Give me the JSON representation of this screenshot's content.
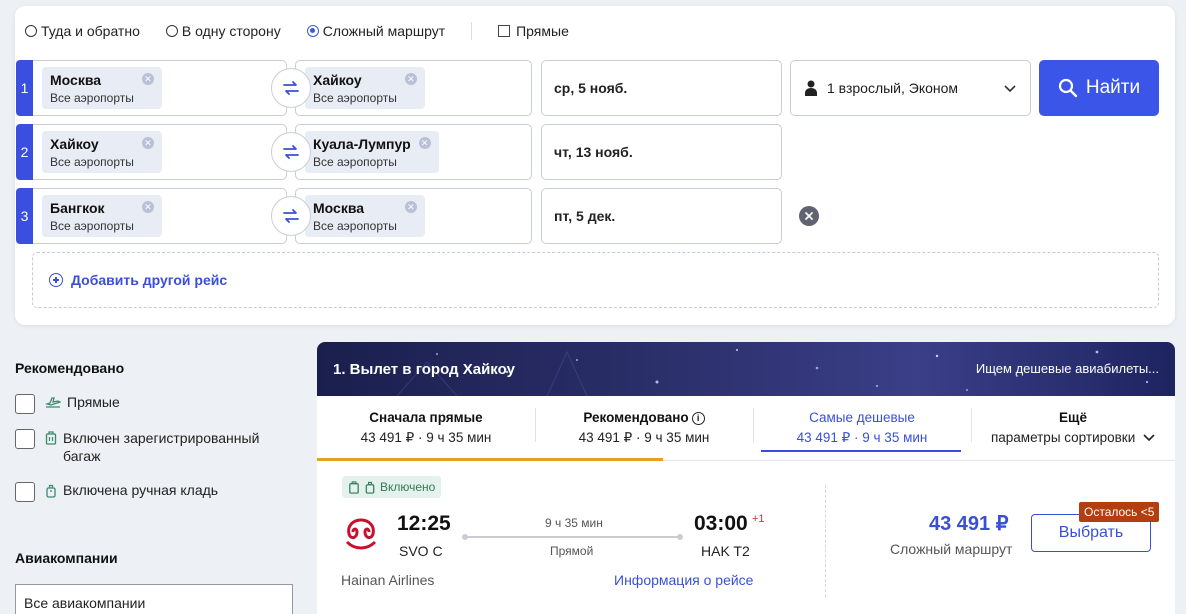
{
  "trip_types": {
    "round_trip": "Туда и обратно",
    "one_way": "В одну сторону",
    "multi_city": "Сложный маршрут",
    "direct": "Прямые"
  },
  "segments": [
    {
      "num": "1",
      "from_city": "Москва",
      "from_sub": "Все аэропорты",
      "to_city": "Хайкоу",
      "to_sub": "Все аэропорты",
      "date": "ср, 5 нояб."
    },
    {
      "num": "2",
      "from_city": "Хайкоу",
      "from_sub": "Все аэропорты",
      "to_city": "Куала-Лумпур",
      "to_sub": "Все аэропорты",
      "date": "чт, 13 нояб."
    },
    {
      "num": "3",
      "from_city": "Бангкок",
      "from_sub": "Все аэропорты",
      "to_city": "Москва",
      "to_sub": "Все аэропорты",
      "date": "пт, 5 дек."
    }
  ],
  "passengers": "1 взрослый, Эконом",
  "find_label": "Найти",
  "add_flight": "Добавить другой рейс",
  "sidebar": {
    "recommended_title": "Рекомендовано",
    "filters": [
      "Прямые",
      "Включен зарегистрированный багаж",
      "Включена ручная кладь"
    ],
    "airlines_title": "Авиакомпании",
    "airlines_select": "Все авиакомпании"
  },
  "results": {
    "banner_title": "1. Вылет в город Хайкоу",
    "searching": "Ищем дешевые авиабилеты...",
    "tabs": [
      {
        "label": "Сначала прямые",
        "value": "43 491 ₽ · 9 ч 35 мин"
      },
      {
        "label": "Рекомендовано",
        "value": "43 491 ₽ · 9 ч 35 мин"
      },
      {
        "label": "Самые дешевые",
        "value": "43 491 ₽ · 9 ч 35 мин"
      },
      {
        "label": "Ещё",
        "value": "параметры сортировки"
      }
    ],
    "flight": {
      "included": "Включено",
      "dep_time": "12:25",
      "dep_code": "SVO C",
      "duration": "9 ч 35 мин",
      "stops": "Прямой",
      "arr_time": "03:00",
      "plus_day": "+1",
      "arr_code": "HAK T2",
      "airline": "Hainan Airlines",
      "info_link": "Информация о рейсе",
      "price": "43 491 ₽",
      "price_sub": "Сложный маршрут",
      "select": "Выбрать",
      "left_badge": "Осталось <5"
    }
  },
  "colors": {
    "accent": "#3a55e8",
    "link": "#3a4fd8",
    "tab_underline_orange": "#e8a21a",
    "badge_red": "#b33f10"
  }
}
